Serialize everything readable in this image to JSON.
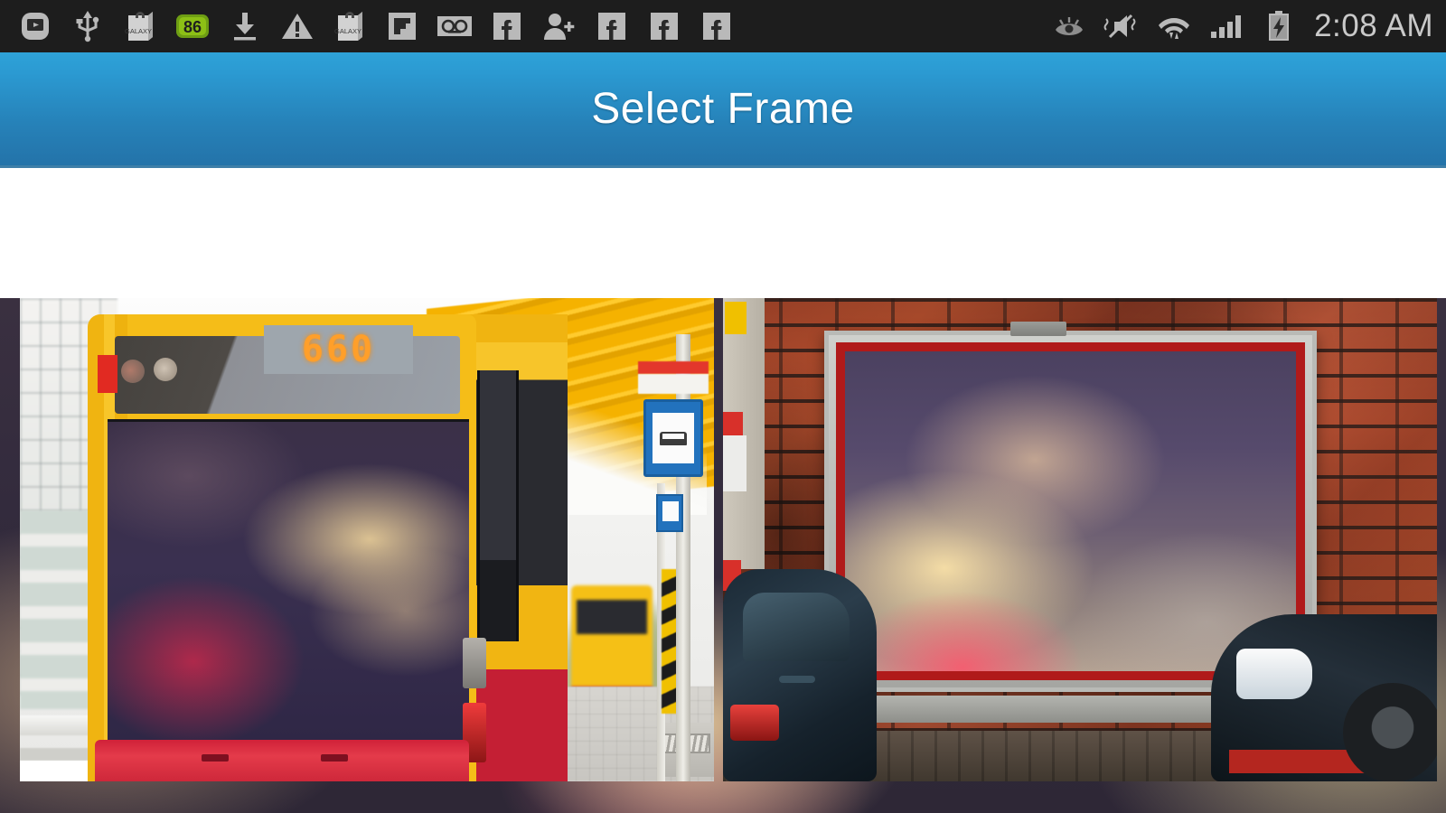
{
  "status_bar": {
    "background_color": "#1d1d1d",
    "clock": "2:08 AM",
    "left_icons": [
      {
        "name": "screen-mirroring-icon",
        "label": "Screen mirroring"
      },
      {
        "name": "usb-icon",
        "label": "USB connected"
      },
      {
        "name": "galaxy-apps-icon",
        "label": "GALAXY"
      },
      {
        "name": "update-badge-icon",
        "label": "86"
      },
      {
        "name": "download-icon",
        "label": "Download complete"
      },
      {
        "name": "warning-icon",
        "label": "Warning"
      },
      {
        "name": "galaxy-apps-icon-2",
        "label": "GALAXY"
      },
      {
        "name": "flipboard-icon",
        "label": "Flipboard"
      },
      {
        "name": "voicemail-icon",
        "label": "Voicemail"
      },
      {
        "name": "facebook-icon-1",
        "label": "Facebook"
      },
      {
        "name": "friend-request-icon",
        "label": "Friend request"
      },
      {
        "name": "facebook-icon-2",
        "label": "Facebook"
      },
      {
        "name": "facebook-icon-3",
        "label": "Facebook"
      },
      {
        "name": "facebook-icon-4",
        "label": "Facebook"
      }
    ],
    "right_icons": [
      {
        "name": "smart-stay-eye-icon",
        "label": "Smart stay"
      },
      {
        "name": "sound-muted-vibrate-icon",
        "label": "Sound off / vibrate"
      },
      {
        "name": "wifi-icon",
        "label": "Wi-Fi connected"
      },
      {
        "name": "cellular-signal-icon",
        "label": "Signal strength"
      },
      {
        "name": "battery-charging-icon",
        "label": "Battery charging"
      }
    ]
  },
  "title_bar": {
    "title": "Select Frame",
    "gradient_top": "#2ea2d8",
    "gradient_bottom": "#2473a9",
    "text_color": "#ffffff"
  },
  "content": {
    "background_color": "#ffffff",
    "blurred_backdrop_color": "#332b3d"
  },
  "frames": [
    {
      "name": "frame-bus-advertisement",
      "description": "Bus rear advertising panel at a bus stop",
      "bus_display_number": "660",
      "accent_colors": {
        "bus_body": "#f5bd18",
        "bumper": "#d02138",
        "ad_panel": "#3a3050"
      }
    },
    {
      "name": "frame-brick-wall-billboard",
      "description": "Billboard mounted on a red brick wall with cars",
      "accent_colors": {
        "brick": "#b0502f",
        "frame": "#b9bab6",
        "inner_border": "#b01a1a"
      }
    }
  ]
}
